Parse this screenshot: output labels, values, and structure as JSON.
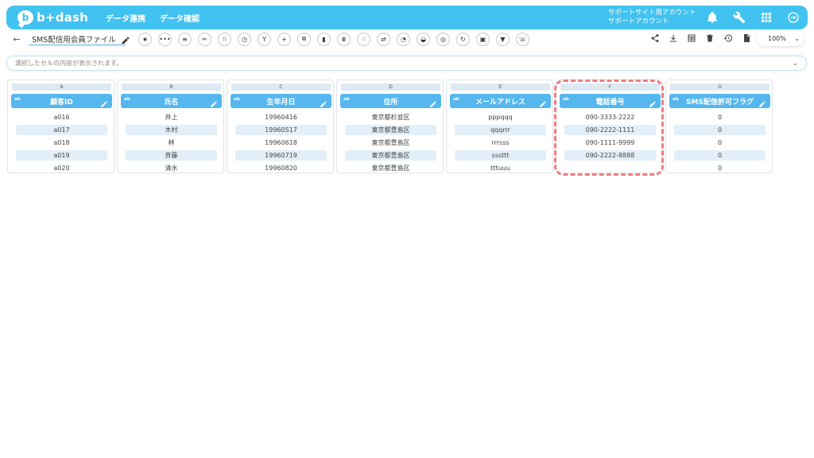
{
  "header": {
    "logo_mark": "b",
    "logo_text": "b+dash",
    "nav": [
      "データ連携",
      "データ確認"
    ],
    "account_line1": "サポートサイト用アカウント",
    "account_line2": "サポートアカウント",
    "brand_color": "#41c2f0",
    "icons": [
      "bell-icon",
      "wrench-icon",
      "grid-icon",
      "logout-icon"
    ]
  },
  "toolbar": {
    "back_glyph": "←",
    "file_name": "SMS配信用会員ファイル",
    "tool_icons": [
      "star-icon",
      "more-icon",
      "list-icon",
      "scissors-icon",
      "split-icon",
      "timer-icon",
      "merge-icon",
      "plus-icon",
      "copy-icon",
      "trash-icon",
      "crown-icon",
      "dots-icon",
      "swap-icon",
      "pie-icon",
      "bag-icon",
      "target-icon",
      "refresh-icon",
      "box-icon",
      "filter-icon",
      "phone-icon"
    ],
    "tool_glyphs": [
      "★",
      "•••",
      "≡",
      "✂",
      "⁝⁝",
      "◷",
      "Y",
      "+",
      "⧉",
      "▮",
      "♛",
      "⁘",
      "⇄",
      "◔",
      "◒",
      "◎",
      "↻",
      "▣",
      "▼",
      "☏"
    ],
    "right_icons": [
      "share-icon",
      "download-icon",
      "table-icon",
      "delete-icon",
      "history-icon",
      "export-icon"
    ],
    "zoom": "100%"
  },
  "cellbar": {
    "placeholder": "選択したセルの内容が表示されます。"
  },
  "columns": [
    {
      "letter": "A",
      "type": "ab",
      "name": "顧客ID",
      "cells": [
        "a016",
        "a017",
        "a018",
        "a019",
        "a020"
      ]
    },
    {
      "letter": "B",
      "type": "ab",
      "name": "氏名",
      "cells": [
        "井上",
        "木村",
        "林",
        "斉藤",
        "清水"
      ]
    },
    {
      "letter": "C",
      "type": "ab",
      "name": "生年月日",
      "cells": [
        "19960416",
        "19960517",
        "19960618",
        "19960719",
        "19960820"
      ]
    },
    {
      "letter": "D",
      "type": "ab",
      "name": "住所",
      "cells": [
        "東京都杉並区",
        "東京都豊島区",
        "東京都豊島区",
        "東京都豊島区",
        "東京都豊島区"
      ]
    },
    {
      "letter": "E",
      "type": "ab",
      "name": "メールアドレス",
      "cells": [
        "pppqqq",
        "qqqrrr",
        "rrrsss",
        "sssttt",
        "tttuuu"
      ]
    },
    {
      "letter": "F",
      "type": "ab",
      "name": "電話番号",
      "cells": [
        "090-3333-2222",
        "090-2222-1111",
        "090-1111-9999",
        "090-2222-8888"
      ]
    },
    {
      "letter": "G",
      "type": "ab",
      "name": "SMS配信許可フラグ",
      "cells": [
        "0",
        "0",
        "0",
        "0",
        "0"
      ]
    }
  ],
  "highlight_color": "#f07a83"
}
